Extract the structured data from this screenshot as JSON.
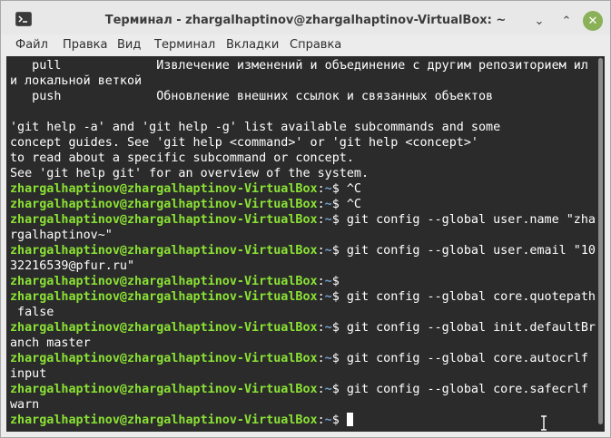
{
  "window": {
    "title": "Терминал - zhargalhaptinov@zhargalhaptinov-VirtualBox: ~",
    "buttons": {
      "minimize": "⌄",
      "maximize": "⌃",
      "close": "✕"
    },
    "icon": "terminal-app-icon"
  },
  "menubar": {
    "items": [
      "Файл",
      "Правка",
      "Вид",
      "Терминал",
      "Вкладки",
      "Справка"
    ]
  },
  "terminal": {
    "prompt_user": "zhargalhaptinov@zhargalhaptinov-VirtualBox",
    "prompt_sep": ":",
    "prompt_path": "~",
    "prompt_end": "$ ",
    "lines": [
      {
        "text": "   pull             Извлечение изменений и объединение с другим репозиторием ил"
      },
      {
        "text": "и локальной веткой"
      },
      {
        "text": "   push             Обновление внешних ссылок и связанных объектов"
      },
      {
        "text": ""
      },
      {
        "text": "'git help -a' and 'git help -g' list available subcommands and some"
      },
      {
        "text": "concept guides. See 'git help <command>' or 'git help <concept>'"
      },
      {
        "text": "to read about a specific subcommand or concept."
      },
      {
        "text": "See 'git help git' for an overview of the system."
      },
      {
        "prompt": true,
        "cmd": "^C"
      },
      {
        "prompt": true,
        "cmd": "^C"
      },
      {
        "prompt": true,
        "cmd": "git config --global user.name \"zha"
      },
      {
        "text": "rgalhaptinov~\""
      },
      {
        "prompt": true,
        "cmd": "git config --global user.email \"10"
      },
      {
        "text": "32216539@pfur.ru\""
      },
      {
        "prompt": true,
        "cmd": ""
      },
      {
        "prompt": true,
        "cmd": "git config --global core.quotepath"
      },
      {
        "text": " false"
      },
      {
        "prompt": true,
        "cmd": "git config --global init.defaultBr"
      },
      {
        "text": "anch master"
      },
      {
        "prompt": true,
        "cmd": "git config --global core.autocrlf"
      },
      {
        "text": "input"
      },
      {
        "prompt": true,
        "cmd": "git config --global core.safecrlf"
      },
      {
        "text": "warn"
      },
      {
        "prompt": true,
        "cmd": "",
        "cursor": true
      }
    ]
  },
  "colors": {
    "terminal_bg": "#2b2b2b",
    "prompt_user": "#8ae234",
    "prompt_path": "#729fcf",
    "close_button": "#8bb158"
  }
}
